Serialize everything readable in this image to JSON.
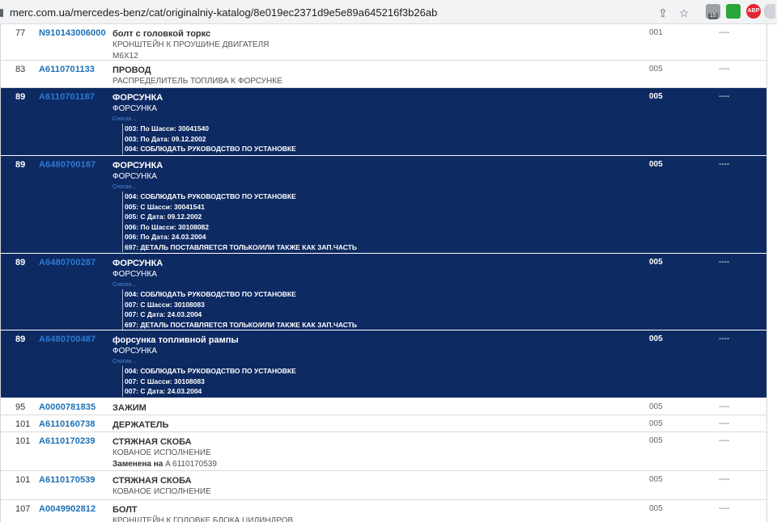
{
  "browser": {
    "url": "merc.com.ua/mercedes-benz/cat/originalniy-katalog/8e019ec2371d9e5e89a645216f3b26ab",
    "share_icon": "share-icon",
    "bookmark_icon": "star-icon",
    "extensions": [
      {
        "name": "printer-extension-icon",
        "badge": "15"
      },
      {
        "name": "green-extension-icon"
      },
      {
        "name": "adblock-extension-icon",
        "label": "ABP"
      }
    ]
  },
  "parts": [
    {
      "pos": "77",
      "pn": "N910143006000",
      "name": "болт с головкой торкс",
      "sub": [
        "КРОНШТЕЙН К ПРОУШИНЕ ДВИГАТЕЛЯ",
        "M6X12"
      ],
      "qty": "001",
      "dash": "----",
      "selected": false
    },
    {
      "pos": "83",
      "pn": "A6110701133",
      "name": "ПРОВОД",
      "sub": [
        "РАСПРЕДЕЛИТЕЛЬ ТОПЛИВА К ФОРСУНКЕ"
      ],
      "qty": "005",
      "dash": "----",
      "selected": false
    },
    {
      "pos": "89",
      "pn": "A6110701187",
      "name": "ФОРСУНКА",
      "sub": [
        "ФОРСУНКА"
      ],
      "notes_label": "Сноски...",
      "notes": [
        "003: По Шасси: 30041540",
        "003: По Дата: 09.12.2002",
        "004: СОБЛЮДАТЬ РУКОВОДСТВО ПО УСТАНОВКЕ"
      ],
      "qty": "005",
      "dash": "----",
      "selected": true
    },
    {
      "pos": "89",
      "pn": "A6480700187",
      "name": "ФОРСУНКА",
      "sub": [
        "ФОРСУНКА"
      ],
      "notes_label": "Сноски...",
      "notes": [
        "004: СОБЛЮДАТЬ РУКОВОДСТВО ПО УСТАНОВКЕ",
        "005: С Шасси: 30041541",
        "005: С Дата: 09.12.2002",
        "006: По Шасси: 30108082",
        "006: По Дата: 24.03.2004",
        "697: ДЕТАЛЬ ПОСТАВЛЯЕТСЯ ТОЛЬКО/ИЛИ ТАКЖЕ КАК ЗАП.ЧАСТЬ"
      ],
      "qty": "005",
      "dash": "----",
      "selected": true
    },
    {
      "pos": "89",
      "pn": "A6480700287",
      "name": "ФОРСУНКА",
      "sub": [
        "ФОРСУНКА"
      ],
      "notes_label": "Сноски...",
      "notes": [
        "004: СОБЛЮДАТЬ РУКОВОДСТВО ПО УСТАНОВКЕ",
        "007: С Шасси: 30108083",
        "007: С Дата: 24.03.2004",
        "697: ДЕТАЛЬ ПОСТАВЛЯЕТСЯ ТОЛЬКО/ИЛИ ТАКЖЕ КАК ЗАП.ЧАСТЬ"
      ],
      "qty": "005",
      "dash": "----",
      "selected": true
    },
    {
      "pos": "89",
      "pn": "A6480700487",
      "name": "форсунка топливной рампы",
      "sub": [
        "ФОРСУНКА"
      ],
      "notes_label": "Сноски...",
      "notes": [
        "004: СОБЛЮДАТЬ РУКОВОДСТВО ПО УСТАНОВКЕ",
        "007: С Шасси: 30108083",
        "007: С Дата: 24.03.2004"
      ],
      "qty": "005",
      "dash": "----",
      "selected": true
    },
    {
      "pos": "95",
      "pn": "A0000781835",
      "name": "ЗАЖИМ",
      "sub": [],
      "qty": "005",
      "dash": "----",
      "selected": false
    },
    {
      "pos": "101",
      "pn": "A6110160738",
      "name": "ДЕРЖАТЕЛЬ",
      "sub": [],
      "qty": "005",
      "dash": "----",
      "selected": false
    },
    {
      "pos": "101",
      "pn": "A6110170239",
      "name": "СТЯЖНАЯ СКОБА",
      "sub": [
        "КОВАНОЕ ИСПОЛНЕНИЕ"
      ],
      "replaced": {
        "label": "Заменена на",
        "pn": "A 6110170539"
      },
      "qty": "005",
      "dash": "----",
      "selected": false
    },
    {
      "pos": "101",
      "pn": "A6110170539",
      "name": "СТЯЖНАЯ СКОБА",
      "sub": [
        "КОВАНОЕ ИСПОЛНЕНИЕ"
      ],
      "qty": "005",
      "dash": "----",
      "selected": false
    },
    {
      "pos": "107",
      "pn": "A0049902812",
      "name": "БОЛТ",
      "sub": [
        "КРОНШТЕЙН К ГОЛОВКЕ БЛОКА ЦИЛИНДРОВ"
      ],
      "qty": "005",
      "dash": "----",
      "selected": false
    }
  ]
}
